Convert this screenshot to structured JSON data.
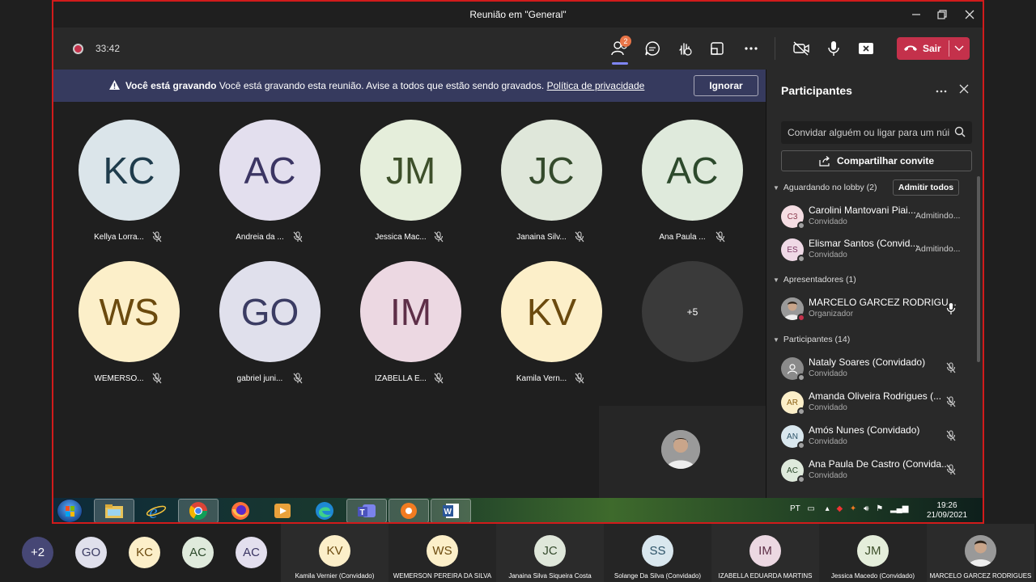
{
  "window": {
    "title": "Reunião em \"General\""
  },
  "toolbar": {
    "timer": "33:42",
    "participants_badge": "2",
    "leave_label": "Sair"
  },
  "banner": {
    "bold": "Você está gravando",
    "message": "Você está gravando esta reunião. Avise a todos que estão sendo gravados.",
    "link": "Política de privacidade",
    "ignore_label": "Ignorar"
  },
  "grid": [
    {
      "initials": "KC",
      "name": "Kellya Lorra...",
      "bg": "#dbe5ea",
      "fg": "#1f3c4c"
    },
    {
      "initials": "AC",
      "name": "Andreia da ...",
      "bg": "#e3dfee",
      "fg": "#3b3563"
    },
    {
      "initials": "JM",
      "name": "Jessica Mac...",
      "bg": "#e5eedb",
      "fg": "#3d4f2a"
    },
    {
      "initials": "JC",
      "name": "Janaina Silv...",
      "bg": "#dfe7da",
      "fg": "#344a2c"
    },
    {
      "initials": "AC",
      "name": "Ana Paula ...",
      "bg": "#dfeadc",
      "fg": "#2d4a2c"
    },
    {
      "initials": "WS",
      "name": "WEMERSO...",
      "bg": "#fcefc9",
      "fg": "#6b4a0e"
    },
    {
      "initials": "GO",
      "name": "gabriel juni...",
      "bg": "#e0e0ec",
      "fg": "#3b3c63"
    },
    {
      "initials": "IM",
      "name": "IZABELLA E...",
      "bg": "#ecd8e2",
      "fg": "#5e2f48"
    },
    {
      "initials": "KV",
      "name": "Kamila Vern...",
      "bg": "#fcefc9",
      "fg": "#6b4a0e"
    },
    {
      "initials": "+5",
      "name": "",
      "bg": "#3a3a3a",
      "fg": "#ffffff"
    }
  ],
  "panel": {
    "title": "Participantes",
    "search_placeholder": "Convidar alguém ou ligar para um núi",
    "share_label": "Compartilhar convite",
    "lobby": {
      "label": "Aguardando no lobby (2)",
      "admit_all": "Admitir todos",
      "people": [
        {
          "initials": "C3",
          "name": "Carolini Mantovani Piai...",
          "role": "Convidado",
          "status": "Admitindo...",
          "bg": "#f5dde3",
          "fg": "#8a3a4d"
        },
        {
          "initials": "ES",
          "name": "Elismar Santos (Convid...",
          "role": "Convidado",
          "status": "Admitindo...",
          "bg": "#efd9e6",
          "fg": "#7b3763"
        }
      ]
    },
    "presenters": {
      "label": "Apresentadores (1)",
      "people": [
        {
          "name": "MARCELO GARCEZ RODRIGU...",
          "role": "Organizador"
        }
      ]
    },
    "participants": {
      "label": "Participantes (14)",
      "people": [
        {
          "initials": "",
          "name": "Nataly Soares (Convidado)",
          "role": "Convidado",
          "bg": "#8a8a8a",
          "fg": "#ffffff"
        },
        {
          "initials": "AR",
          "name": "Amanda Oliveira Rodrigues (...",
          "role": "Convidado",
          "bg": "#fcefc9",
          "fg": "#8a5e12"
        },
        {
          "initials": "AN",
          "name": "Amós Nunes (Convidado)",
          "role": "Convidado",
          "bg": "#d9e7ee",
          "fg": "#2d5368"
        },
        {
          "initials": "AC",
          "name": "Ana Paula De Castro (Convida...",
          "role": "Convidado",
          "bg": "#dfeadc",
          "fg": "#2d4a2c"
        }
      ]
    }
  },
  "taskbar": {
    "lang": "PT",
    "time": "19:26",
    "date": "21/09/2021"
  },
  "strip": {
    "avatars": [
      {
        "initials": "+2",
        "bg": "#464775",
        "fg": "#ffffff"
      },
      {
        "initials": "GO",
        "bg": "#e0e0ec",
        "fg": "#3b3c63"
      },
      {
        "initials": "KC",
        "bg": "#fcefc9",
        "fg": "#6b4a0e"
      },
      {
        "initials": "AC",
        "bg": "#dfeadc",
        "fg": "#2d4a2c"
      },
      {
        "initials": "AC",
        "bg": "#e3dfee",
        "fg": "#3b3563"
      }
    ],
    "cards": [
      {
        "initials": "KV",
        "name": "Kamila Vernier (Convidado)",
        "bg": "#fcefc9",
        "fg": "#6b4a0e"
      },
      {
        "initials": "WS",
        "name": "WEMERSON PEREIRA DA SILVA",
        "bg": "#fcefc9",
        "fg": "#6b4a0e"
      },
      {
        "initials": "JC",
        "name": "Janaina Silva Siqueira Costa",
        "bg": "#dfe7da",
        "fg": "#344a2c"
      },
      {
        "initials": "SS",
        "name": "Solange Da Silva (Convidado)",
        "bg": "#d9e7ee",
        "fg": "#2d5368"
      },
      {
        "initials": "IM",
        "name": "IZABELLA EDUARDA MARTINS",
        "bg": "#ecd8e2",
        "fg": "#5e2f48"
      },
      {
        "initials": "JM",
        "name": "Jessica Macedo (Convidado)",
        "bg": "#e5eedb",
        "fg": "#3d4f2a"
      },
      {
        "initials": "",
        "name": "MARCELO GARCEZ RODRIGUES",
        "bg": "#777777",
        "fg": "#ffffff"
      }
    ]
  }
}
